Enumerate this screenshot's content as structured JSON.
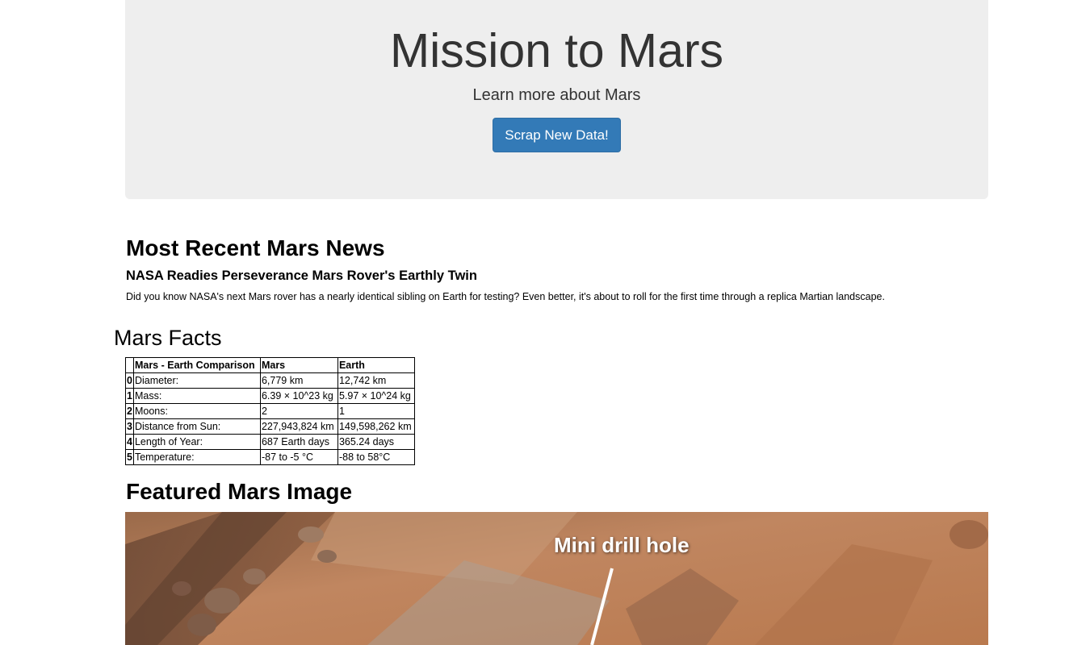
{
  "header": {
    "title": "Mission to Mars",
    "subtitle": "Learn more about Mars",
    "button_label": "Scrap New Data!",
    "button_color": "#337ab7",
    "background": "#eeeeee"
  },
  "news": {
    "heading": "Most Recent Mars News",
    "title": "NASA Readies Perseverance Mars Rover's Earthly Twin",
    "paragraph": "Did you know NASA's next Mars rover has a nearly identical sibling on Earth for testing? Even better, it's about to roll for the first time through a replica Martian landscape."
  },
  "facts": {
    "heading": "Mars Facts",
    "columns": [
      "",
      "Mars - Earth Comparison",
      "Mars",
      "Earth"
    ],
    "rows": [
      [
        "0",
        "Diameter:",
        "6,779 km",
        "12,742 km"
      ],
      [
        "1",
        "Mass:",
        "6.39 × 10^23 kg",
        "5.97 × 10^24 kg"
      ],
      [
        "2",
        "Moons:",
        "2",
        "1"
      ],
      [
        "3",
        "Distance from Sun:",
        "227,943,824 km",
        "149,598,262 km"
      ],
      [
        "4",
        "Length of Year:",
        "687 Earth days",
        "365.24 days"
      ],
      [
        "5",
        "Temperature:",
        "-87 to -5 °C",
        "-88 to 58°C"
      ]
    ]
  },
  "featured": {
    "heading": "Featured Mars Image",
    "image_label": "Mini drill hole"
  }
}
